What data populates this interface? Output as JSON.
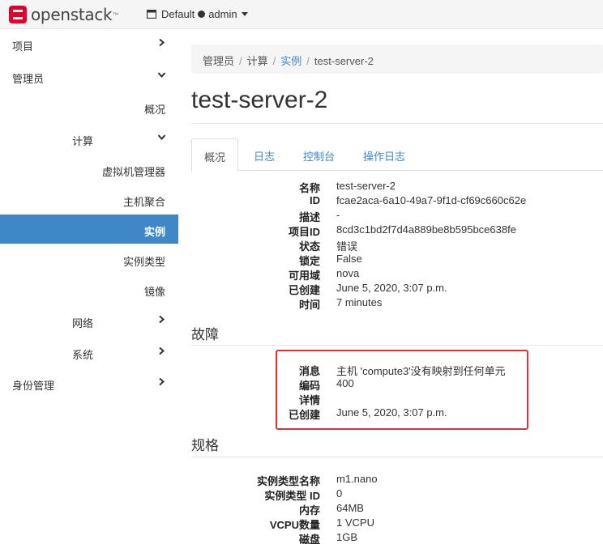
{
  "brand": {
    "name": "openstack",
    "tm": "™"
  },
  "topbar": {
    "project_label": "Default",
    "user_label": "admin"
  },
  "sidebar": {
    "items": [
      {
        "label": "项目"
      },
      {
        "label": "管理员"
      },
      {
        "label": "概况"
      },
      {
        "label": "计算"
      },
      {
        "label": "虚拟机管理器"
      },
      {
        "label": "主机聚合"
      },
      {
        "label": "实例"
      },
      {
        "label": "实例类型"
      },
      {
        "label": "镜像"
      },
      {
        "label": "网络"
      },
      {
        "label": "系统"
      },
      {
        "label": "身份管理"
      }
    ]
  },
  "breadcrumb": {
    "items": [
      "管理员",
      "计算",
      "实例",
      "test-server-2"
    ]
  },
  "page_title": "test-server-2",
  "tabs": [
    "概况",
    "日志",
    "控制台",
    "操作日志"
  ],
  "overview": {
    "rows": [
      {
        "key": "名称",
        "value": "test-server-2"
      },
      {
        "key": "ID",
        "value": "fcae2aca-6a10-49a7-9f1d-cf69c660c62e"
      },
      {
        "key": "描述",
        "value": "-"
      },
      {
        "key": "项目ID",
        "value": "8cd3c1bd2f7d4a889be8b595bce638fe"
      },
      {
        "key": "状态",
        "value": "错误"
      },
      {
        "key": "锁定",
        "value": "False"
      },
      {
        "key": "可用域",
        "value": "nova"
      },
      {
        "key": "已创建",
        "value": "June 5, 2020, 3:07 p.m."
      },
      {
        "key": "时间",
        "value": "7 minutes"
      }
    ]
  },
  "fault": {
    "title": "故障",
    "rows": [
      {
        "key": "消息",
        "value": "主机 'compute3'没有映射到任何单元"
      },
      {
        "key": "编码",
        "value": "400"
      },
      {
        "key": "详情",
        "value": ""
      },
      {
        "key": "已创建",
        "value": "June 5, 2020, 3:07 p.m."
      }
    ]
  },
  "specs": {
    "title": "规格",
    "rows": [
      {
        "key": "实例类型名称",
        "value": "m1.nano"
      },
      {
        "key": "实例类型 ID",
        "value": "0"
      },
      {
        "key": "内存",
        "value": "64MB"
      },
      {
        "key": "VCPU数量",
        "value": "1 VCPU"
      },
      {
        "key": "磁盘",
        "value": "1GB"
      }
    ]
  },
  "colors": {
    "accent": "#3f88c8",
    "highlight": "#e03232"
  }
}
